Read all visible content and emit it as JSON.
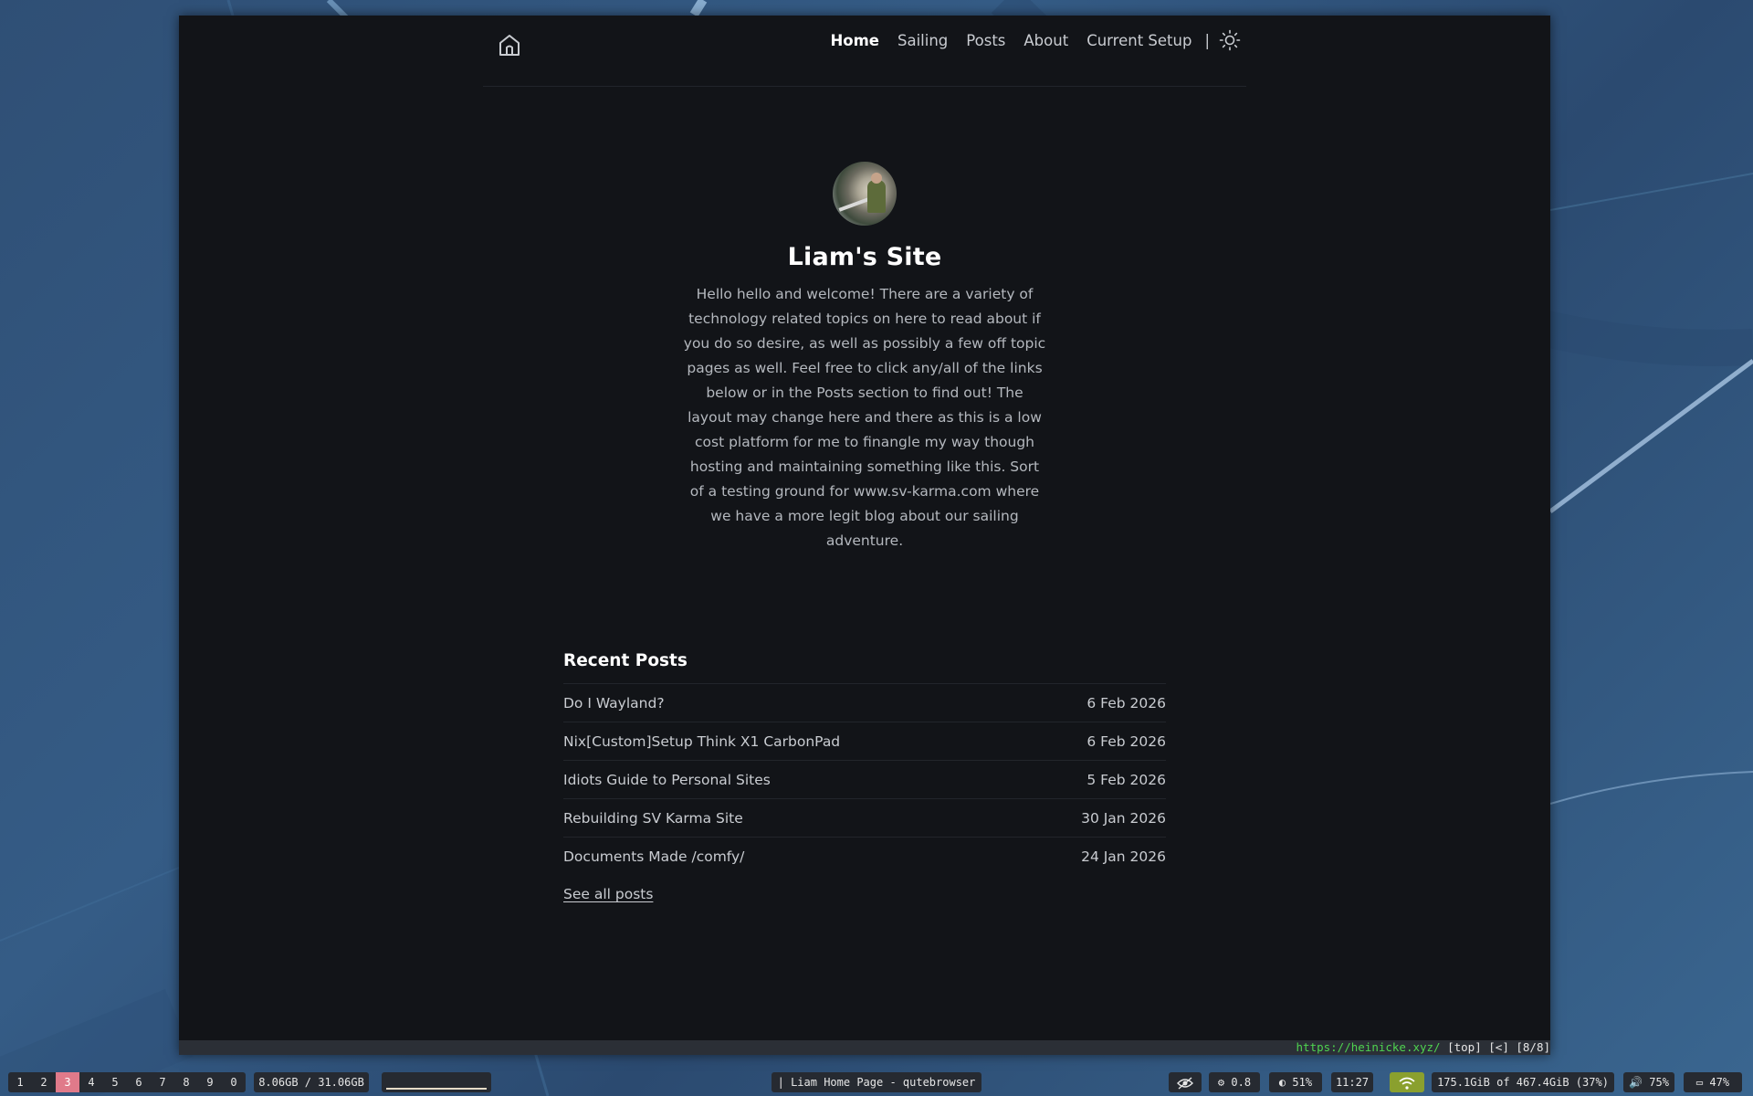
{
  "browser": {
    "statusbar": {
      "url": "https://heinicke.xyz/",
      "info": "[top] [<] [8/8]"
    }
  },
  "header": {
    "home_icon": "home-icon",
    "nav": [
      {
        "label": "Home",
        "active": true
      },
      {
        "label": "Sailing"
      },
      {
        "label": "Posts"
      },
      {
        "label": "About"
      },
      {
        "label": "Current Setup"
      }
    ],
    "separator": "|",
    "theme_icon": "sun-icon"
  },
  "hero": {
    "title": "Liam's Site",
    "intro": "Hello hello and welcome! There are a variety of technology related topics on here to read about if you do so desire, as well as possibly a few off topic pages as well. Feel free to click any/all of the links below or in the Posts section to find out! The layout may change here and there as this is a low cost platform for me to finangle my way though hosting and maintaining something like this. Sort of a testing ground for www.sv-karma.com where we have a more legit blog about our sailing adventure."
  },
  "recent_posts": {
    "heading": "Recent Posts",
    "posts": [
      {
        "title": "Do I Wayland?",
        "date": "6 Feb 2026"
      },
      {
        "title": "Nix[Custom]Setup Think X1 CarbonPad",
        "date": "6 Feb 2026"
      },
      {
        "title": "Idiots Guide to Personal Sites",
        "date": "5 Feb 2026"
      },
      {
        "title": "Rebuilding SV Karma Site",
        "date": "30 Jan 2026"
      },
      {
        "title": "Documents Made /comfy/",
        "date": "24 Jan 2026"
      }
    ],
    "see_all": "See all posts"
  },
  "taskbar": {
    "workspaces": [
      "1",
      "2",
      "3",
      "4",
      "5",
      "6",
      "7",
      "8",
      "9",
      "0"
    ],
    "active_workspace": "3",
    "memory": "8.06GB / 31.06GB",
    "window_title": "| Liam Home Page - qutebrowser",
    "brightness_setting": "0.8",
    "backlight": "51%",
    "clock": "11:27",
    "disk": "175.1GiB of 467.4GiB (37%)",
    "volume": "75%",
    "battery": "47%"
  },
  "colors": {
    "page_bg": "#121418",
    "active_workspace": "#e07a8a",
    "wifi": "#8aa02e",
    "url": "#4fd34f"
  }
}
